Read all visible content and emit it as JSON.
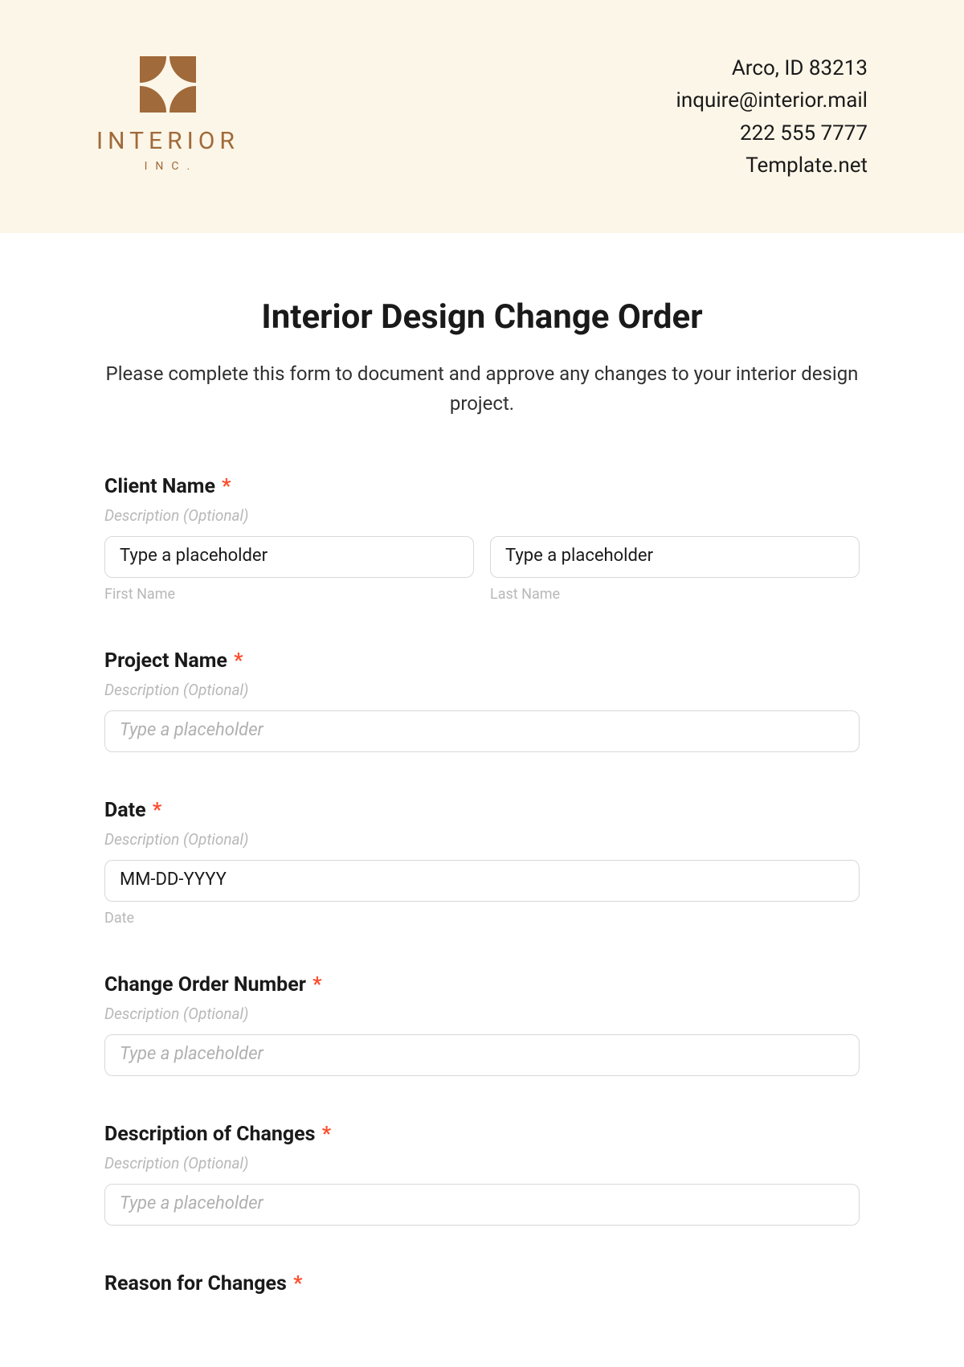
{
  "header": {
    "logo_text": "INTERIOR",
    "logo_sub": "INC.",
    "contact": {
      "address": "Arco, ID 83213",
      "email": "inquire@interior.mail",
      "phone": "222 555 7777",
      "site": "Template.net"
    }
  },
  "form": {
    "title": "Interior Design Change Order",
    "intro": "Please complete this form to document and approve any changes to your interior design project.",
    "desc_optional": "Description (Optional)",
    "placeholder_text": "Type a placeholder",
    "client_name": {
      "label": "Client Name",
      "first_value": "Type a placeholder",
      "first_sub": "First Name",
      "last_value": "Type a placeholder",
      "last_sub": "Last Name"
    },
    "project_name": {
      "label": "Project Name"
    },
    "date": {
      "label": "Date",
      "value": "MM-DD-YYYY",
      "sub": "Date"
    },
    "change_order_number": {
      "label": "Change Order Number"
    },
    "description_of_changes": {
      "label": "Description of Changes"
    },
    "reason_for_changes": {
      "label": "Reason for Changes"
    },
    "required_mark": "*"
  }
}
